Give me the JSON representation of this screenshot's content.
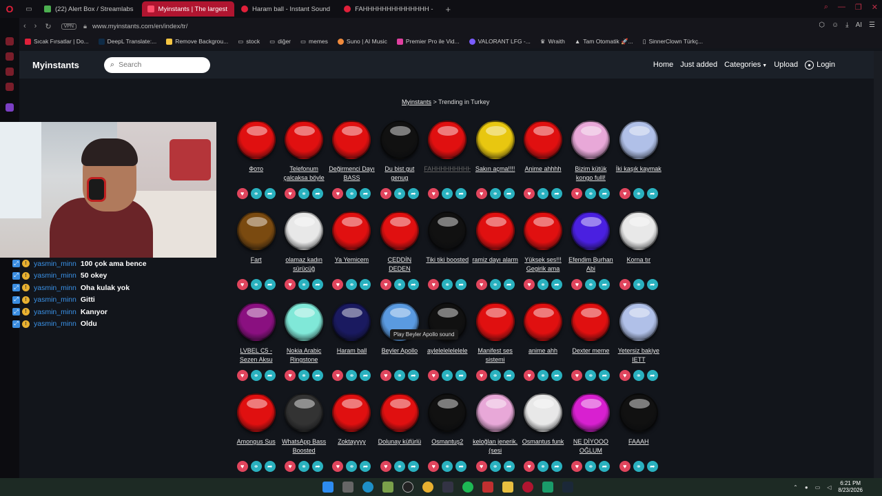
{
  "browser": {
    "tabs": [
      {
        "title": "(22) Alert Box / Streamlabs",
        "color": "#4caf50"
      },
      {
        "title": "Myinstants | The largest",
        "color": "#e0203a",
        "active": true
      },
      {
        "title": "Haram ball - Instant Sound",
        "color": "#e0203a"
      },
      {
        "title": "FAHHHHHHHHHHHHHH - ",
        "color": "#e0203a"
      }
    ],
    "vpn": "VPN",
    "url": "www.myinstants.com/en/index/tr/",
    "bookmarks": [
      {
        "label": "Sıcak Fırsatlar | Do...",
        "color": "#e0203a"
      },
      {
        "label": "DeepL Translate:...",
        "color": "#0f2b46"
      },
      {
        "label": "Remove Backgrou...",
        "color": "#f5c542"
      },
      {
        "label": "stock",
        "color": "#888888"
      },
      {
        "label": "diğer",
        "color": "#888888"
      },
      {
        "label": "memes",
        "color": "#888888"
      },
      {
        "label": "Suno | AI Music",
        "color": "#f08a3c"
      },
      {
        "label": "Premier Pro ile Vid...",
        "color": "#e040a0"
      },
      {
        "label": "VALORANT LFG -...",
        "color": "#7a5cff"
      },
      {
        "label": "Wraith",
        "color": "#dddddd"
      },
      {
        "label": "Tam Otomatik 🚀...",
        "color": "#dddddd"
      },
      {
        "label": "SinnerClown Türkç...",
        "color": "#dddddd"
      }
    ]
  },
  "site": {
    "logo": "Myinstants",
    "search_placeholder": "Search",
    "nav": {
      "home": "Home",
      "just_added": "Just added",
      "categories": "Categories",
      "upload": "Upload",
      "login": "Login"
    },
    "breadcrumb": {
      "root": "Myinstants",
      "sep": ">",
      "current": "Trending in Turkey"
    },
    "tooltip": "Play Beyler Apollo sound"
  },
  "chat": [
    {
      "user": "yasmin_minn",
      "msg": "100 çok ama bence"
    },
    {
      "user": "yasmin_minn",
      "msg": "50 okey"
    },
    {
      "user": "yasmin_minn",
      "msg": "Oha kulak yok"
    },
    {
      "user": "yasmin_minn",
      "msg": "Gitti"
    },
    {
      "user": "yasmin_minn",
      "msg": "Kanıyor"
    },
    {
      "user": "yasmin_minn",
      "msg": "Oldu"
    }
  ],
  "instants": [
    {
      "label": "Фото",
      "color": "#e01010"
    },
    {
      "label": "Telefonum çalcaksa böyle",
      "color": "#e01010"
    },
    {
      "label": "Değirmenci Dayı BASS",
      "color": "#e01010"
    },
    {
      "label": "Du bist gut genug",
      "color": "#111111"
    },
    {
      "label": "FAHHHHHHHHHHHHHHH",
      "color": "#e01010",
      "faded": true
    },
    {
      "label": "Sakın açma!!!!",
      "color": "#e8c710"
    },
    {
      "label": "Anime ahhhh",
      "color": "#e01010"
    },
    {
      "label": "Bizim kütük kongo fulll!",
      "color": "#e8a8d8"
    },
    {
      "label": "İki kaşık kaymak",
      "color": "#b0c0e8"
    },
    {
      "label": "Fart",
      "color": "#7a4a10"
    },
    {
      "label": "olamaz kadın sürücüğ",
      "color": "#e8e8e8"
    },
    {
      "label": "Ya Yemicem",
      "color": "#e01010"
    },
    {
      "label": "CEDDİN DEDEN",
      "color": "#e01010"
    },
    {
      "label": "Tiki tiki boosted",
      "color": "#111111"
    },
    {
      "label": "ramiz dayı alarm",
      "color": "#e01010"
    },
    {
      "label": "Yüksek ses!!! Gegirik ama",
      "color": "#e01010"
    },
    {
      "label": "Efendim Burhan Abi",
      "color": "#4a20e0"
    },
    {
      "label": "Korna tır",
      "color": "#e8e8e8"
    },
    {
      "label": "LVBEL C5 - Sezen Aksu",
      "color": "#8a1080"
    },
    {
      "label": "Nokia Arabic Ringstone",
      "color": "#80e8d8"
    },
    {
      "label": "Haram ball",
      "color": "#1a1a60"
    },
    {
      "label": "Beyler Apollo",
      "color": "#5a9ae0"
    },
    {
      "label": "aylelelelelelele",
      "color": "#111111"
    },
    {
      "label": "Manifest ses sistemi",
      "color": "#e01010"
    },
    {
      "label": "anime ahh",
      "color": "#e01010"
    },
    {
      "label": "Dexter meme",
      "color": "#e01010"
    },
    {
      "label": "Yetersiz bakiye IETT",
      "color": "#b0c0e8"
    },
    {
      "label": "Amongus Sus",
      "color": "#e01010"
    },
    {
      "label": "WhatsApp Bass Boosted",
      "color": "#333333"
    },
    {
      "label": "Zoktayyyy",
      "color": "#e01010"
    },
    {
      "label": "Dolunay küfürlü",
      "color": "#e01010"
    },
    {
      "label": "Osmantuş2",
      "color": "#111111"
    },
    {
      "label": "keloğlan jenerik. (sesi",
      "color": "#e8a8d8"
    },
    {
      "label": "Osmantus funk",
      "color": "#e8e8e8"
    },
    {
      "label": "NE DİYOOO OĞLUM",
      "color": "#d820d0"
    },
    {
      "label": "FAAAH",
      "color": "#111111"
    }
  ],
  "taskbar": {
    "time": "6:21 PM",
    "date": "8/23/2026"
  }
}
